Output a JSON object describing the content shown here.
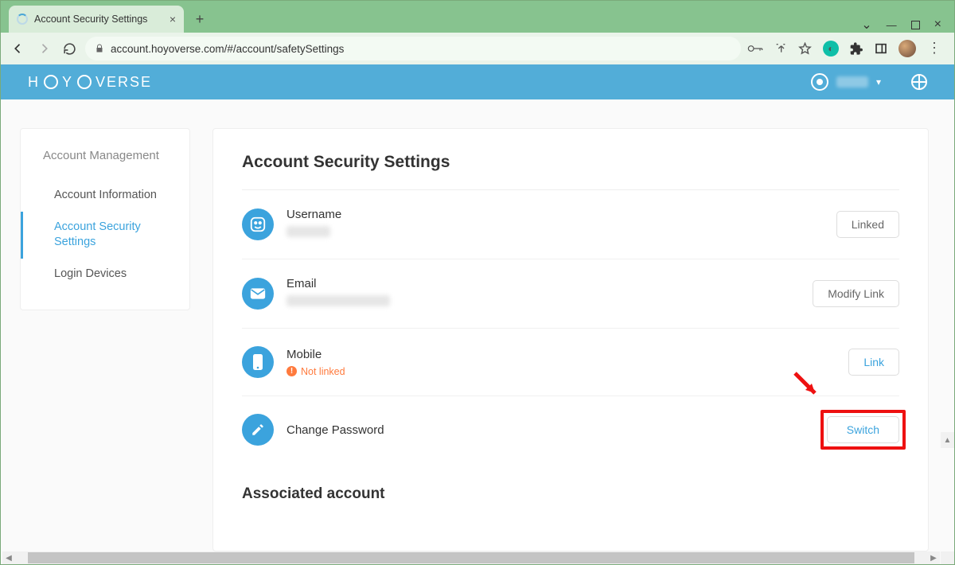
{
  "browser": {
    "tab_title": "Account Security Settings",
    "url": "account.hoyoverse.com/#/account/safetySettings"
  },
  "brand": "HOYOVERSE",
  "sidebar": {
    "header": "Account Management",
    "items": [
      {
        "label": "Account Information"
      },
      {
        "label": "Account Security Settings"
      },
      {
        "label": "Login Devices"
      }
    ]
  },
  "page": {
    "title": "Account Security Settings",
    "rows": {
      "username": {
        "label": "Username",
        "button": "Linked"
      },
      "email": {
        "label": "Email",
        "button": "Modify Link"
      },
      "mobile": {
        "label": "Mobile",
        "status": "Not linked",
        "button": "Link"
      },
      "password": {
        "label": "Change Password",
        "button": "Switch"
      }
    },
    "section2": "Associated account"
  }
}
